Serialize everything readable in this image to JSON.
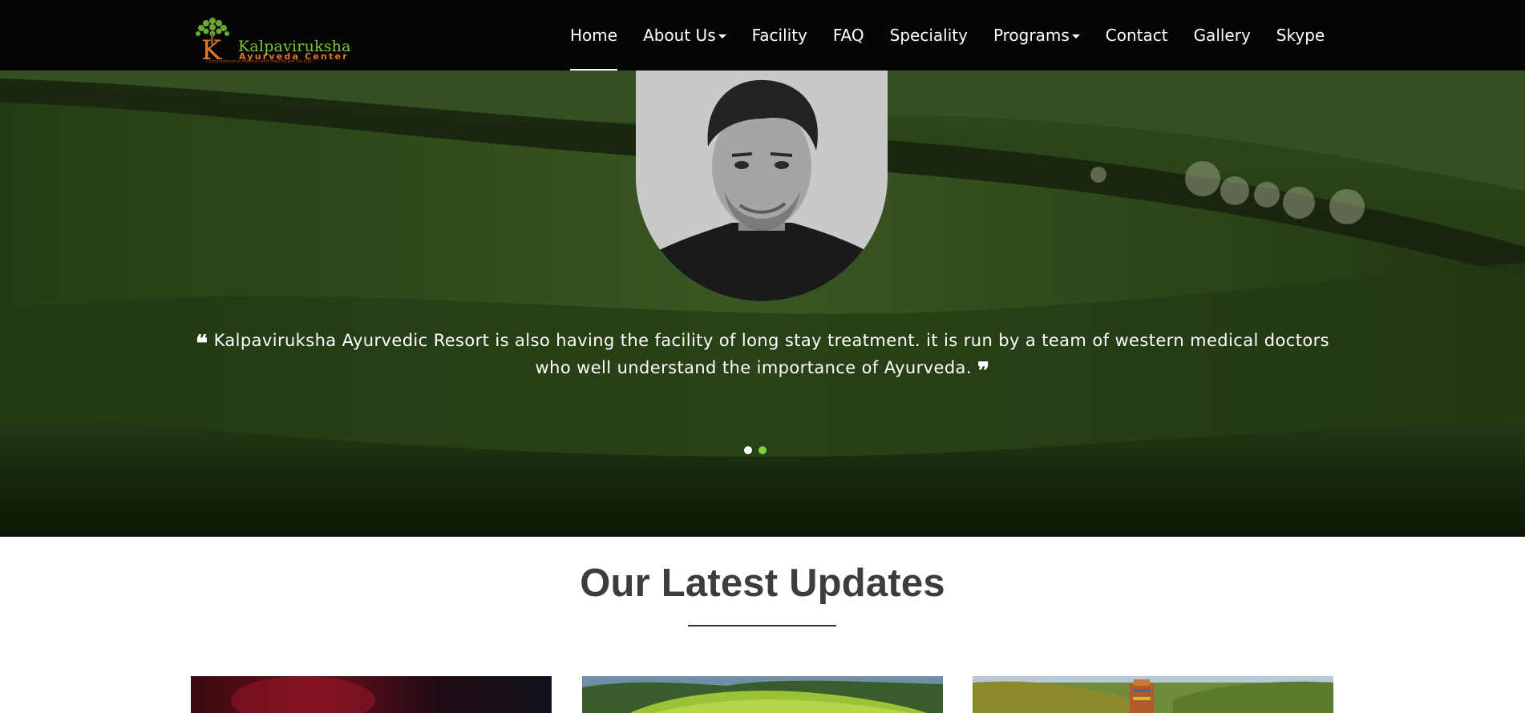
{
  "brand": {
    "name": "Kalpaviruksha",
    "subtitle": "Ayurveda Center",
    "tagline": "Comprehensive Medical and Healthcare Facility"
  },
  "nav": {
    "items": [
      {
        "label": "Home",
        "active": true,
        "dropdown": false
      },
      {
        "label": "About Us",
        "active": false,
        "dropdown": true
      },
      {
        "label": "Facility",
        "active": false,
        "dropdown": false
      },
      {
        "label": "FAQ",
        "active": false,
        "dropdown": false
      },
      {
        "label": "Speciality",
        "active": false,
        "dropdown": false
      },
      {
        "label": "Programs",
        "active": false,
        "dropdown": true
      },
      {
        "label": "Contact",
        "active": false,
        "dropdown": false
      },
      {
        "label": "Gallery",
        "active": false,
        "dropdown": false
      },
      {
        "label": "Skype",
        "active": false,
        "dropdown": false
      }
    ]
  },
  "testimonial": {
    "quote": "Kalpaviruksha Ayurvedic Resort is also having the facility of long stay treatment. it is run by a team of western medical doctors who well understand the importance of Ayurveda.",
    "open_mark": "❝",
    "close_mark": "❞",
    "slides": 2,
    "active_slide": 2
  },
  "updates": {
    "title": "Our Latest Updates"
  },
  "colors": {
    "nav_bg": "#050505",
    "accent_green": "#7fd13b",
    "logo_orange": "#e2762b",
    "heading": "#3d3d3d"
  }
}
